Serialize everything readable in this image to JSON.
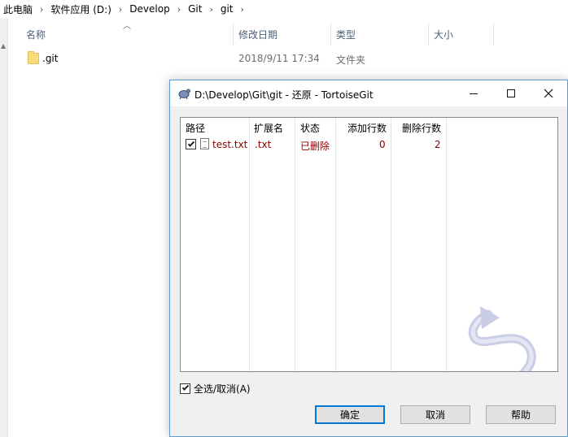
{
  "breadcrumb": {
    "items": [
      "此电脑",
      "软件应用 (D:)",
      "Develop",
      "Git",
      "git"
    ],
    "separator": "›"
  },
  "explorer": {
    "columns": [
      "名称",
      "修改日期",
      "类型",
      "大小"
    ],
    "rows": [
      {
        "name": ".git",
        "date": "2018/9/11 17:34",
        "type": "文件夹",
        "size": ""
      }
    ]
  },
  "dialog": {
    "title": "D:\\Develop\\Git\\git - 还原 - TortoiseGit",
    "columns": [
      "路径",
      "扩展名",
      "状态",
      "添加行数",
      "删除行数"
    ],
    "rows": [
      {
        "checked": true,
        "path": "test.txt",
        "ext": ".txt",
        "status": "已删除",
        "added": "0",
        "deleted": "2"
      }
    ],
    "select_all_label": "全选/取消(A)",
    "buttons": {
      "ok": "确定",
      "cancel": "取消",
      "help": "帮助"
    }
  },
  "colors": {
    "accent": "#0078d7",
    "window_border": "#5d9bd4",
    "status_text": "#8b0000",
    "header_text": "#4c607a"
  }
}
